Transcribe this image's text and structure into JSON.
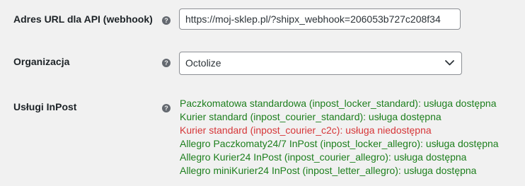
{
  "fields": {
    "webhook": {
      "label": "Adres URL dla API (webhook)",
      "value": "https://moj-sklep.pl/?shipx_webhook=206053b727c208f34"
    },
    "organization": {
      "label": "Organizacja",
      "selected": "Octolize"
    },
    "inpost_services": {
      "label": "Usługi InPost",
      "items": [
        {
          "text": "Paczkomatowa standardowa (inpost_locker_standard): usługa dostępna",
          "available": true
        },
        {
          "text": "Kurier standard (inpost_courier_standard): usługa dostępna",
          "available": true
        },
        {
          "text": "Kurier standard (inpost_courier_c2c): usługa niedostępna",
          "available": false
        },
        {
          "text": "Allegro Paczkomaty24/7 InPost (inpost_locker_allegro): usługa dostępna",
          "available": true
        },
        {
          "text": "Allegro Kurier24 InPost (inpost_courier_allegro): usługa dostępna",
          "available": true
        },
        {
          "text": "Allegro miniKurier24 InPost (inpost_letter_allegro): usługa dostępna",
          "available": true
        }
      ]
    }
  },
  "help_icon_glyph": "?",
  "colors": {
    "available": "#1d7f1d",
    "unavailable": "#d63638",
    "help_icon": "#646970"
  }
}
